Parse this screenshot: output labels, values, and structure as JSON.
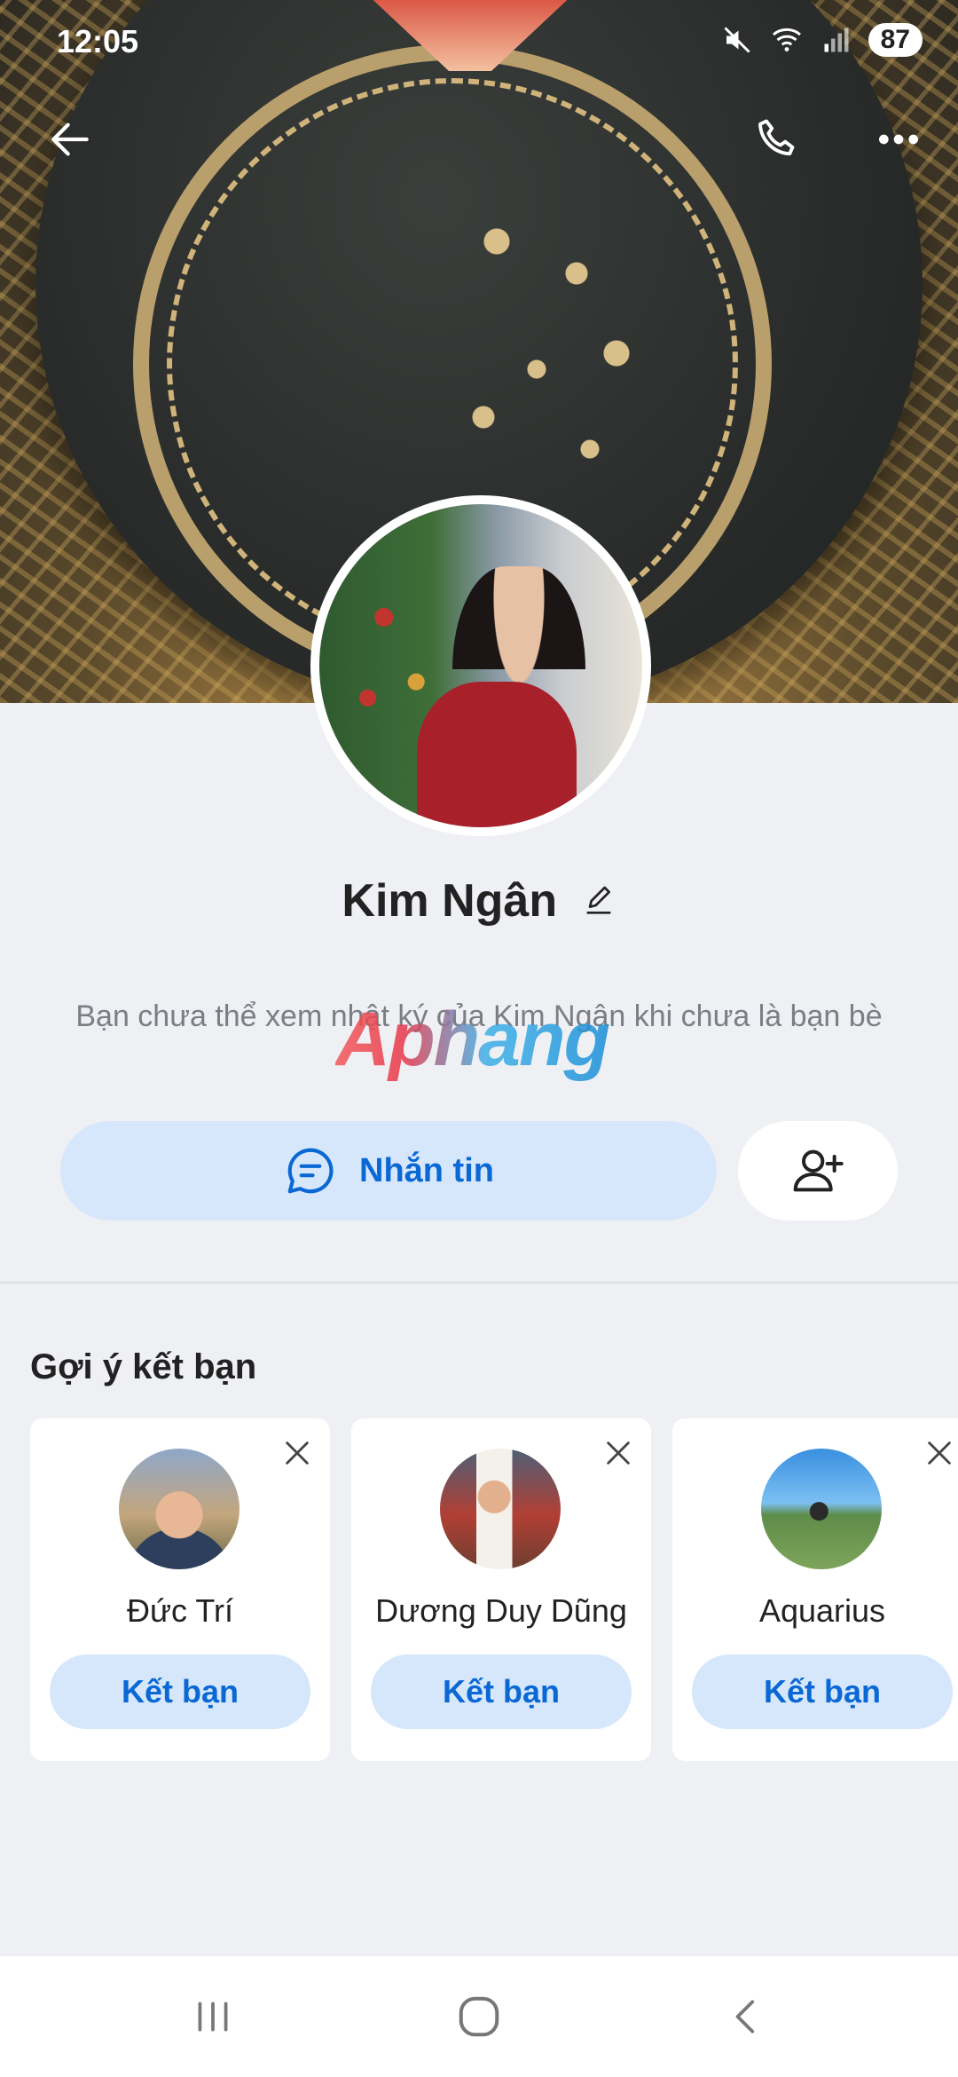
{
  "status_bar": {
    "time": "12:05",
    "battery": "87"
  },
  "profile": {
    "name": "Kim Ngân",
    "notice": "Bạn chưa thể xem nhật ký của Kim Ngân khi chưa là bạn bè",
    "watermark": "Aphang"
  },
  "actions": {
    "message_label": "Nhắn tin"
  },
  "suggestions": {
    "title": "Gợi ý kết bạn",
    "items": [
      {
        "name": "Đức Trí",
        "button": "Kết bạn"
      },
      {
        "name": "Dương Duy Dũng",
        "button": "Kết bạn"
      },
      {
        "name": "Aquarius",
        "button": "Kết bạn"
      }
    ]
  },
  "colors": {
    "accent": "#0a68d4",
    "button_bg": "#d6e7fb",
    "page_bg": "#eff0f4"
  },
  "icons": [
    "back-arrow-icon",
    "phone-icon",
    "more-icon",
    "mute-icon",
    "wifi-icon",
    "signal-icon",
    "edit-icon",
    "chat-bubble-icon",
    "add-friend-icon",
    "close-icon",
    "recent-apps-icon",
    "home-icon",
    "nav-back-icon"
  ]
}
